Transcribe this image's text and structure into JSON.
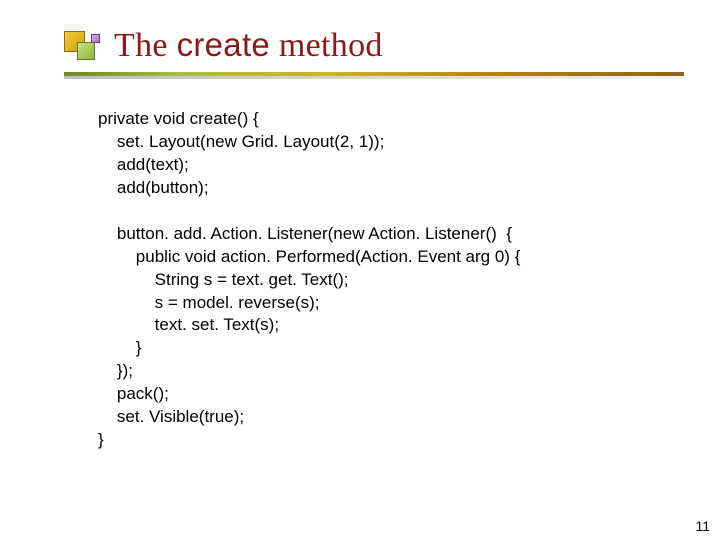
{
  "title": {
    "prefix": "The ",
    "keyword": "create",
    "suffix": " method"
  },
  "code": {
    "l1": "private void create() {",
    "l2": "    set. Layout(new Grid. Layout(2, 1));",
    "l3": "    add(text);",
    "l4": "    add(button);",
    "l5": "",
    "l6": "    button. add. Action. Listener(new Action. Listener()  {",
    "l7": "        public void action. Performed(Action. Event arg 0) {",
    "l8": "            String s = text. get. Text();",
    "l9": "            s = model. reverse(s);",
    "l10": "            text. set. Text(s);",
    "l11": "        }",
    "l12": "    });",
    "l13": "    pack();",
    "l14": "    set. Visible(true);",
    "l15": "}"
  },
  "page_number": "11"
}
